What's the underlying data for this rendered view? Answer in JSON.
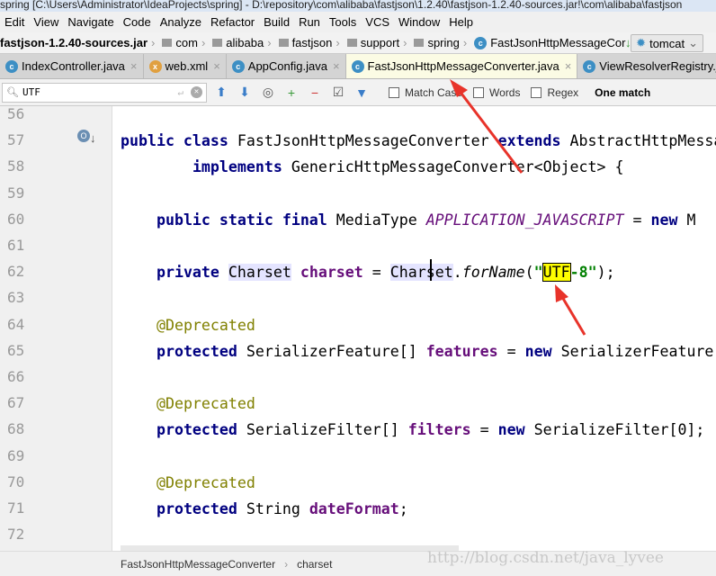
{
  "title": "spring [C:\\Users\\Administrator\\IdeaProjects\\spring] - D:\\repository\\com\\alibaba\\fastjson\\1.2.40\\fastjson-1.2.40-sources.jar!\\com\\alibaba\\fastjson",
  "menu": [
    "Edit",
    "View",
    "Navigate",
    "Code",
    "Analyze",
    "Refactor",
    "Build",
    "Run",
    "Tools",
    "VCS",
    "Window",
    "Help"
  ],
  "nav": {
    "jar": "fastjson-1.2.40-sources.jar",
    "crumbs": [
      "com",
      "alibaba",
      "fastjson",
      "support",
      "spring"
    ],
    "cls": "FastJsonHttpMessageCor",
    "run_config": "tomcat"
  },
  "tabs": [
    {
      "label": "IndexController.java"
    },
    {
      "label": "web.xml"
    },
    {
      "label": "AppConfig.java"
    },
    {
      "label": "FastJsonHttpMessageConverter.java",
      "active": true
    },
    {
      "label": "ViewResolverRegistry.ja"
    }
  ],
  "search": {
    "value": "UTF",
    "match_case": "Match Case",
    "words": "Words",
    "regex": "Regex",
    "result": "One match"
  },
  "line_numbers": [
    "56",
    "57",
    "58",
    "59",
    "60",
    "61",
    "62",
    "63",
    "64",
    "65",
    "66",
    "67",
    "68",
    "69",
    "70",
    "71",
    "72"
  ],
  "code": [
    [],
    [
      [
        "kw",
        "public class "
      ],
      [
        "plain",
        "FastJsonHttpMessageConverter "
      ],
      [
        "kw",
        "extends "
      ],
      [
        "plain",
        "AbstractHttpMessa"
      ]
    ],
    [
      [
        "plain",
        "        "
      ],
      [
        "kw",
        "implements "
      ],
      [
        "plain",
        "GenericHttpMessageConverter<Object> {"
      ]
    ],
    [],
    [
      [
        "plain",
        "    "
      ],
      [
        "kw",
        "public static final "
      ],
      [
        "plain",
        "MediaType "
      ],
      [
        "sfld",
        "APPLICATION_JAVASCRIPT"
      ],
      [
        "plain",
        " = "
      ],
      [
        "kw",
        "new "
      ],
      [
        "plain",
        "M"
      ]
    ],
    [],
    [
      [
        "plain",
        "    "
      ],
      [
        "kw",
        "private "
      ],
      [
        "hl",
        "Charset"
      ],
      [
        "plain",
        " "
      ],
      [
        "fld",
        "charset"
      ],
      [
        "plain",
        " = "
      ],
      [
        "hl",
        "Charset"
      ],
      [
        "plain",
        "."
      ],
      [
        "mth",
        "forName"
      ],
      [
        "plain",
        "("
      ],
      [
        "str",
        "\""
      ],
      [
        "found",
        "UTF"
      ],
      [
        "str",
        "-8\""
      ],
      [
        "plain",
        ");"
      ]
    ],
    [],
    [
      [
        "plain",
        "    "
      ],
      [
        "ann",
        "@Deprecated"
      ]
    ],
    [
      [
        "plain",
        "    "
      ],
      [
        "kw",
        "protected "
      ],
      [
        "plain",
        "SerializerFeature[] "
      ],
      [
        "fld",
        "features"
      ],
      [
        "plain",
        " = "
      ],
      [
        "kw",
        "new "
      ],
      [
        "plain",
        "SerializerFeature"
      ]
    ],
    [],
    [
      [
        "plain",
        "    "
      ],
      [
        "ann",
        "@Deprecated"
      ]
    ],
    [
      [
        "plain",
        "    "
      ],
      [
        "kw",
        "protected "
      ],
      [
        "plain",
        "SerializeFilter[] "
      ],
      [
        "fld",
        "filters"
      ],
      [
        "plain",
        " = "
      ],
      [
        "kw",
        "new "
      ],
      [
        "plain",
        "SerializeFilter[0];"
      ]
    ],
    [],
    [
      [
        "plain",
        "    "
      ],
      [
        "ann",
        "@Deprecated"
      ]
    ],
    [
      [
        "plain",
        "    "
      ],
      [
        "kw",
        "protected "
      ],
      [
        "plain",
        "String "
      ],
      [
        "fld",
        "dateFormat"
      ],
      [
        "plain",
        ";"
      ]
    ],
    []
  ],
  "status": {
    "cls": "FastJsonHttpMessageConverter",
    "member": "charset"
  },
  "watermark": "http://blog.csdn.net/java_lyvee",
  "colors": {
    "keyword": "#000080",
    "field": "#660e7a",
    "annotation": "#808000",
    "string": "#008000",
    "arrow": "#e8332a"
  }
}
